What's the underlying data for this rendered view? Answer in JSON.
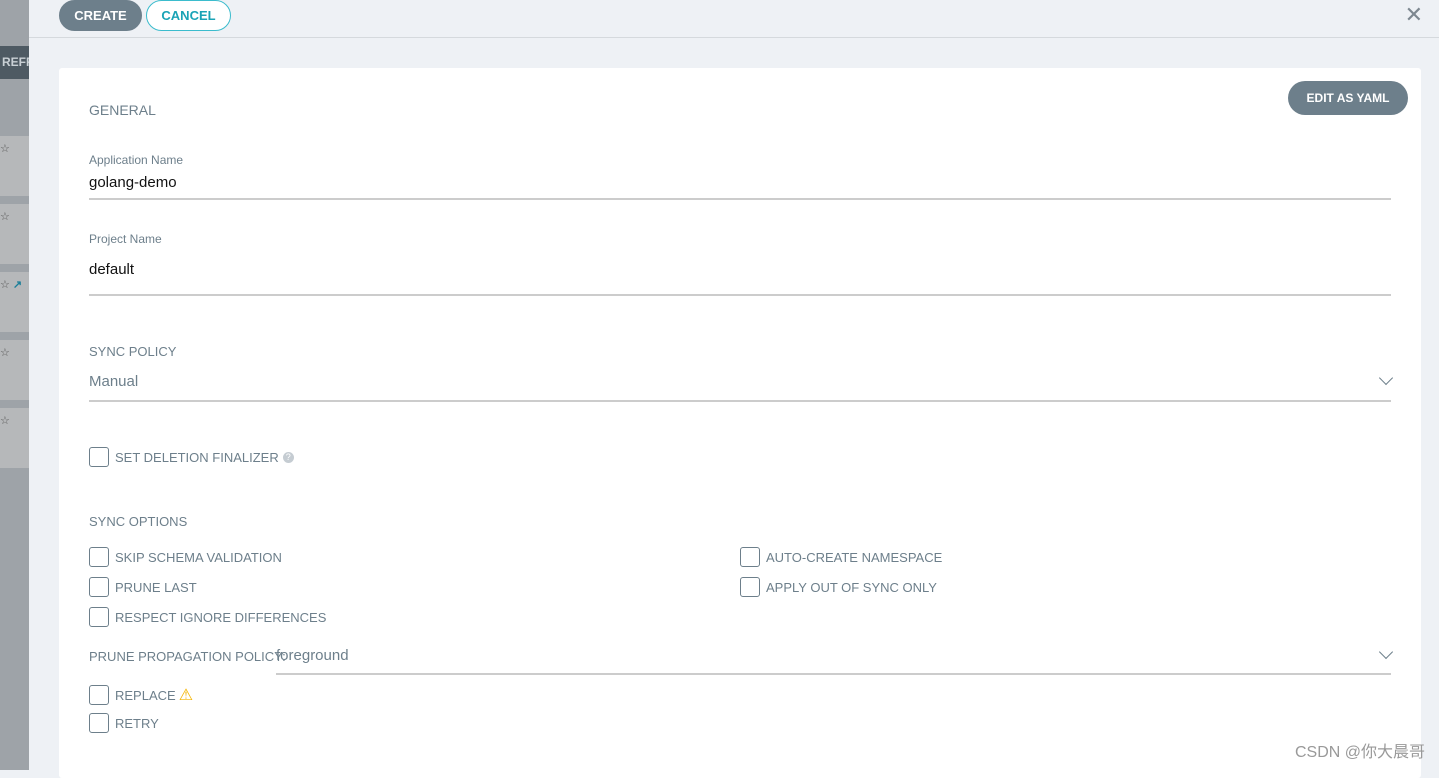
{
  "background": {
    "refresh_label": "REFR",
    "rows": [
      {
        "star": "☆"
      },
      {
        "star": "☆"
      },
      {
        "star": "☆",
        "external": true
      },
      {
        "star": "☆"
      },
      {
        "star": "☆"
      }
    ]
  },
  "toolbar": {
    "create_label": "CREATE",
    "cancel_label": "CANCEL",
    "close_icon": "close-icon"
  },
  "form": {
    "edit_yaml_label": "EDIT AS YAML",
    "general_title": "GENERAL",
    "app_name_label": "Application Name",
    "app_name_value": "golang-demo",
    "project_label": "Project Name",
    "project_value": "default",
    "sync_policy_label": "SYNC POLICY",
    "sync_policy_value": "Manual",
    "deletion_finalizer_label": "SET DELETION FINALIZER",
    "sync_options_title": "SYNC OPTIONS",
    "options_left": [
      "SKIP SCHEMA VALIDATION",
      "PRUNE LAST",
      "RESPECT IGNORE DIFFERENCES"
    ],
    "options_right": [
      "AUTO-CREATE NAMESPACE",
      "APPLY OUT OF SYNC ONLY"
    ],
    "prune_policy_label": "PRUNE PROPAGATION POLICY:",
    "prune_policy_value": "foreground",
    "replace_label": "REPLACE",
    "retry_label": "RETRY"
  },
  "colors": {
    "primary_button": "#6d7f8b",
    "accent": "#1aa3b6",
    "warning": "#f4b400"
  },
  "watermark": "CSDN @你大晨哥"
}
